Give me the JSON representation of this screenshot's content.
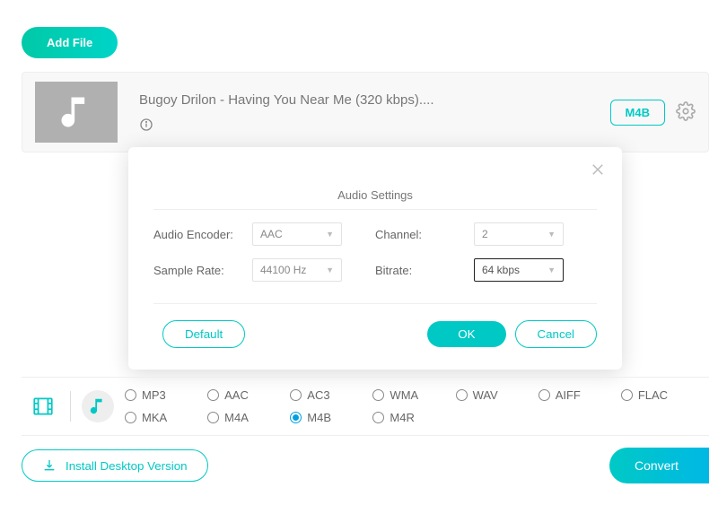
{
  "header": {
    "add_file_label": "Add File"
  },
  "file": {
    "title": "Bugoy Drilon - Having You Near Me (320 kbps)....",
    "format_badge": "M4B"
  },
  "modal": {
    "title": "Audio Settings",
    "labels": {
      "encoder": "Audio Encoder:",
      "channel": "Channel:",
      "sample_rate": "Sample Rate:",
      "bitrate": "Bitrate:"
    },
    "values": {
      "encoder": "AAC",
      "channel": "2",
      "sample_rate": "44100 Hz",
      "bitrate": "64 kbps"
    },
    "buttons": {
      "default": "Default",
      "ok": "OK",
      "cancel": "Cancel"
    }
  },
  "formats": {
    "r0": [
      "MP3",
      "AAC",
      "AC3",
      "WMA",
      "WAV",
      "AIFF",
      "FLAC"
    ],
    "r1": [
      "MKA",
      "M4A",
      "M4B",
      "M4R"
    ],
    "selected": "M4B"
  },
  "footer": {
    "install": "Install Desktop Version",
    "convert": "Convert"
  }
}
